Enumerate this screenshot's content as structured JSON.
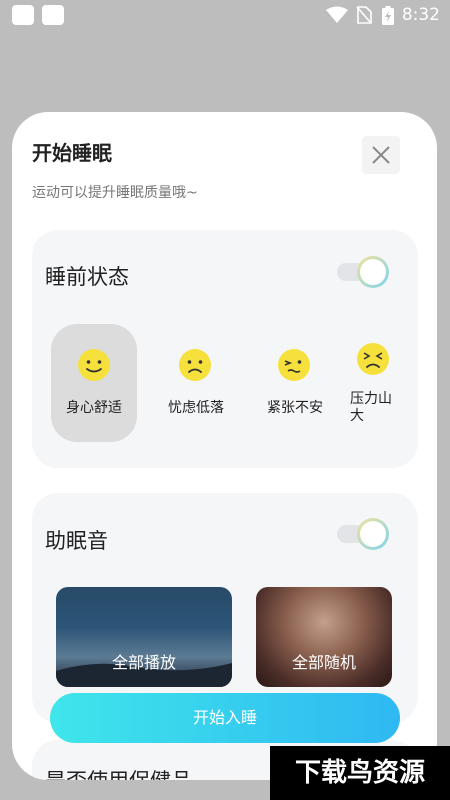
{
  "status_bar": {
    "time": "8:32",
    "icons": [
      "app-square-icon",
      "app-square-icon",
      "wifi-icon",
      "no-sim-icon",
      "battery-charging-icon"
    ]
  },
  "sheet": {
    "title": "开始睡眠",
    "subtitle": "运动可以提升睡眠质量哦~",
    "close_icon": "close-icon"
  },
  "pre_sleep": {
    "title": "睡前状态",
    "toggle_on": true,
    "moods": [
      {
        "label": "身心舒适",
        "icon": "happy-face-icon",
        "selected": true
      },
      {
        "label": "忧虑低落",
        "icon": "sad-face-icon",
        "selected": false
      },
      {
        "label": "紧张不安",
        "icon": "nervous-face-icon",
        "selected": false
      },
      {
        "label": "压力山大",
        "icon": "stressed-face-icon",
        "selected": false
      }
    ]
  },
  "sleep_sound": {
    "title": "助眠音",
    "toggle_on": true,
    "options": [
      {
        "label": "全部播放"
      },
      {
        "label": "全部随机"
      }
    ]
  },
  "next_section": {
    "title": "是否使用保健品"
  },
  "start_button": {
    "label": "开始入睡"
  },
  "watermark": {
    "text": "下载鸟资源"
  },
  "colors": {
    "accent_start": "#3fe6ea",
    "accent_end": "#2fb8f2",
    "card_bg": "#f5f6f8",
    "selected_bg": "#dcdcdc",
    "face": "#f6e13c"
  }
}
